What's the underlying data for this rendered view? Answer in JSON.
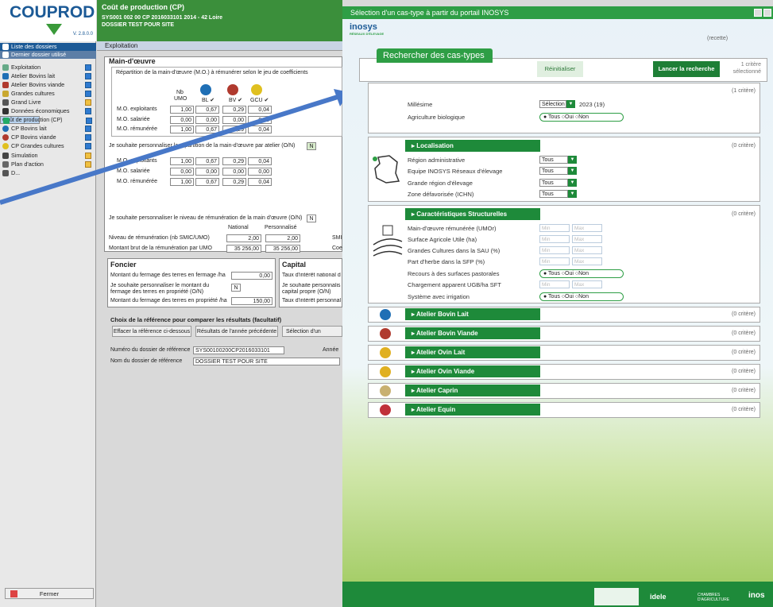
{
  "app": {
    "logo": "COUPROD",
    "version": "V. 2.8.0.0"
  },
  "header": {
    "title": "Coût de production (CP)",
    "line1": "SYS001 002 00 CP 2016033101 2014 - 42  Loire",
    "line2": "DOSSIER TEST POUR SITE"
  },
  "tab": "Exploitation",
  "sidebar": {
    "items": [
      {
        "label": "Liste des dossiers"
      },
      {
        "label": "Dernier dossier utilisé"
      },
      {
        "label": "Exploitation"
      },
      {
        "label": "Atelier Bovins lait"
      },
      {
        "label": "Atelier Bovins viande"
      },
      {
        "label": "Grandes cultures"
      },
      {
        "label": "Grand Livre"
      },
      {
        "label": "Données économiques"
      },
      {
        "label": "Coût de production (CP)"
      },
      {
        "label": "CP Bovins lait"
      },
      {
        "label": "CP Bovins viande"
      },
      {
        "label": "CP Grandes cultures"
      },
      {
        "label": "Simulation"
      },
      {
        "label": "Plan d'action"
      },
      {
        "label": "D..."
      }
    ],
    "close": "Fermer"
  },
  "mo": {
    "title": "Main-d'œuvre",
    "desc": "Répartition de la main-d'œuvre (M.O.) à rémunérer selon le jeu de coefficients",
    "col_nb": "Nb",
    "col_umo": "UMO",
    "cols": [
      "BL ✔",
      "BV ✔",
      "GCU ✔"
    ],
    "rows": [
      {
        "label": "M.O. exploitants",
        "v": [
          "1,00",
          "0,67",
          "0,29",
          "0,04"
        ]
      },
      {
        "label": "M.O. salariée",
        "v": [
          "0,00",
          "0,00",
          "0,00",
          "0,00"
        ]
      },
      {
        "label": "M.O. rémunérée",
        "v": [
          "1,00",
          "0,67",
          "0,29",
          "0,04"
        ]
      }
    ],
    "perso_q": "Je souhaite personnaliser la répartition de la main-d'œuvre par atelier (O/N)",
    "perso_val": "N",
    "rows2": [
      {
        "label": "M.O. exploitants",
        "v": [
          "1,00",
          "0,67",
          "0,29",
          "0,04"
        ]
      },
      {
        "label": "M.O. salariée",
        "v": [
          "0,00",
          "0,00",
          "0,00",
          "0,00"
        ]
      },
      {
        "label": "M.O. rémunérée",
        "v": [
          "1,00",
          "0,67",
          "0,29",
          "0,04"
        ]
      }
    ],
    "remu_q": "Je souhaite personnaliser le niveau de rémunération de la main d'œuvre (O/N)",
    "remu_val": "N",
    "col_national": "National",
    "col_perso": "Personnalisé",
    "niveau_label": "Niveau de rémunération (nb SMIC/UMO)",
    "niveau_nat": "2,00",
    "niveau_perso": "2,00",
    "niveau_suffix": "SMI",
    "montant_label": "Montant brut de la rémunération par UMO",
    "montant_nat": "35 256,00",
    "montant_perso": "35 256,00",
    "montant_suffix": "Coe"
  },
  "foncier": {
    "title": "Foncier",
    "l1": "Montant du fermage des terres en fermage /ha",
    "v1": "0,00",
    "l2": "Je souhaite personnaliser le montant du fermage des terres en propriété (O/N)",
    "v2": "N",
    "l3": "Montant du fermage des terres en propriété /ha",
    "v3": "150,00"
  },
  "capital": {
    "title": "Capital",
    "l1": "Taux d'intérêt national d",
    "l2": "Je souhaite personnalis capital propre (O/N)",
    "l3": "Taux d'intérêt personnal"
  },
  "ref": {
    "title": "Choix de la référence pour comparer les résultats (facultatif)",
    "b1": "Effacer la référence ci-dessous",
    "b2": "Résultats de l'année précédente",
    "b3": "Sélection d'un",
    "num_label": "Numéro du dossier de référence",
    "num_val": "SYS00100200CP2016033101",
    "annee_label": "Année",
    "nom_label": "Nom du dossier de référence",
    "nom_val": "DOSSIER TEST POUR SITE"
  },
  "modal": {
    "title": "Sélection d'un cas-type à partir du portail INOSYS",
    "brand": "inosys",
    "brand_sub": "RÉSEAUX D'ÉLEVAGE",
    "env": "(recette)",
    "search_tab": "Rechercher des cas-types",
    "reset": "Réinitialiser",
    "launch": "Lancer la recherche",
    "crit_sel_1": "1 critère",
    "crit_sel_2": "sélectionné",
    "g1": {
      "crit": "(1 critère)",
      "millesime": "Millésime",
      "sel": "Sélection",
      "sel_val": "2023 (19)",
      "bio": "Agriculture biologique"
    },
    "radio": {
      "tous": "Tous",
      "oui": "Oui",
      "non": "Non"
    },
    "loc": {
      "title": "Localisation",
      "crit": "(0 critère)",
      "items": [
        "Région administrative",
        "Equipe INOSYS Réseaux d'élevage",
        "Grande région d'élevage",
        "Zone défavorisée (ICHN)"
      ],
      "val": "Tous"
    },
    "struct": {
      "title": "Caractéristiques Structurelles",
      "crit": "(0 critère)",
      "items": [
        "Main-d'œuvre rémunérée (UMOr)",
        "Surface Agricole Utile (ha)",
        "Grandes Cultures dans la SAU (%)",
        "Part d'herbe dans la SFP (%)",
        "Recours à des surfaces pastorales",
        "Chargement apparent UGB/ha SFT",
        "Système avec irrigation"
      ],
      "min": "Min",
      "max": "Max"
    },
    "ateliers": [
      {
        "label": "Atelier Bovin Lait",
        "crit": "(0 critère)",
        "color": "#1f6fb5"
      },
      {
        "label": "Atelier Bovin Viande",
        "crit": "(0 critère)",
        "color": "#b03a2e"
      },
      {
        "label": "Atelier Ovin Lait",
        "crit": "(0 critère)",
        "color": "#e0b020"
      },
      {
        "label": "Atelier Ovin Viande",
        "crit": "(0 critère)",
        "color": "#e0b020"
      },
      {
        "label": "Atelier Caprin",
        "crit": "(0 critère)",
        "color": "#c8b070"
      },
      {
        "label": "Atelier Equin",
        "crit": "(0 critère)",
        "color": "#c0303a"
      }
    ],
    "footer_idele": "idele",
    "footer_chambres": "CHAMBRES D'AGRICULTURE",
    "footer_inosys": "inos"
  }
}
